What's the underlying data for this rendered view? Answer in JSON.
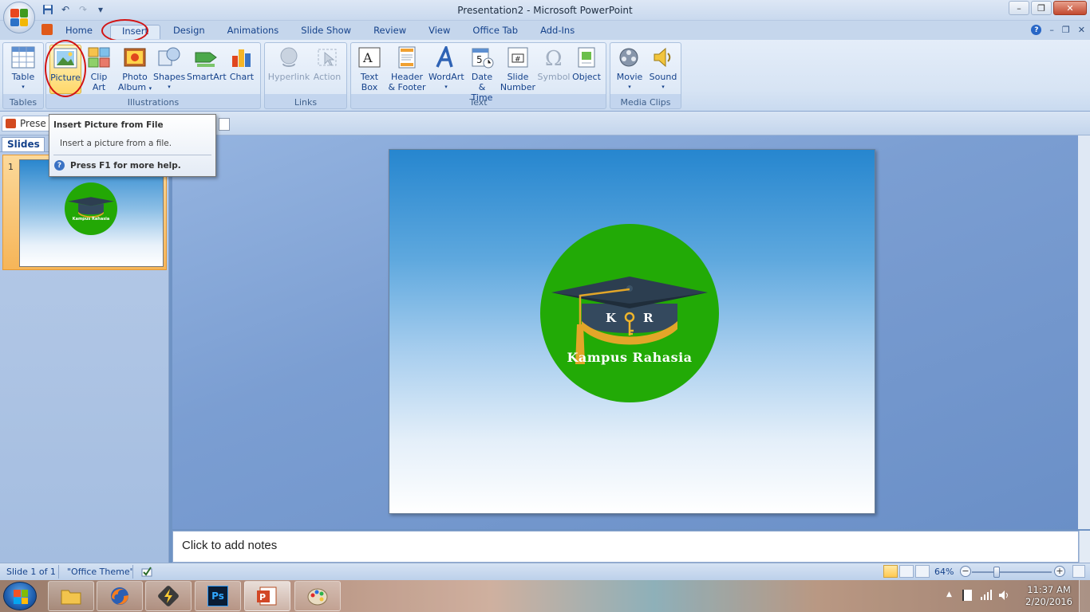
{
  "window": {
    "title": "Presentation2 - Microsoft PowerPoint",
    "minimize": "–",
    "maximize": "❐",
    "close": "✕"
  },
  "qat": {
    "save": "save-icon",
    "undo": "↶",
    "redo": "↷",
    "more": "▾"
  },
  "tabs": [
    "Home",
    "Insert",
    "Design",
    "Animations",
    "Slide Show",
    "Review",
    "View",
    "Office Tab",
    "Add-Ins"
  ],
  "active_tab": "Insert",
  "ribbon": {
    "tables": {
      "label": "Tables",
      "table": "Table"
    },
    "illustrations": {
      "label": "Illustrations",
      "picture": "Picture",
      "clip_art_1": "Clip",
      "clip_art_2": "Art",
      "photo_album_1": "Photo",
      "photo_album_2": "Album",
      "shapes": "Shapes",
      "smartart": "SmartArt",
      "chart": "Chart"
    },
    "links": {
      "label": "Links",
      "hyperlink": "Hyperlink",
      "action": "Action"
    },
    "text": {
      "label": "Text",
      "text_box_1": "Text",
      "text_box_2": "Box",
      "header_footer_1": "Header",
      "header_footer_2": "& Footer",
      "wordart": "WordArt",
      "date_time_1": "Date",
      "date_time_2": "& Time",
      "slide_number_1": "Slide",
      "slide_number_2": "Number",
      "symbol": "Symbol",
      "object": "Object"
    },
    "media": {
      "label": "Media Clips",
      "movie": "Movie",
      "sound": "Sound"
    }
  },
  "doc_tab": {
    "label": "Prese"
  },
  "tooltip": {
    "title": "Insert Picture from File",
    "description": "Insert a picture from a file.",
    "help": "Press F1 for more help."
  },
  "slides_pane": {
    "tab_label": "Slides",
    "slide_number": "1",
    "thumb_text": "Kampus Rahasia"
  },
  "slide": {
    "logo_letters_left": "K",
    "logo_letters_right": "R",
    "logo_text": "Kampus Rahasia"
  },
  "notes": {
    "placeholder": "Click to add notes"
  },
  "status": {
    "slide_info": "Slide 1 of 1",
    "theme": "\"Office Theme\"",
    "zoom": "64%",
    "zoom_minus": "−",
    "zoom_plus": "+"
  },
  "clock": {
    "time": "11:37 AM",
    "date": "2/20/2016"
  },
  "colors": {
    "accent_red": "#d21414",
    "logo_green": "#22aa06",
    "ribbon_blue": "#15428b"
  }
}
